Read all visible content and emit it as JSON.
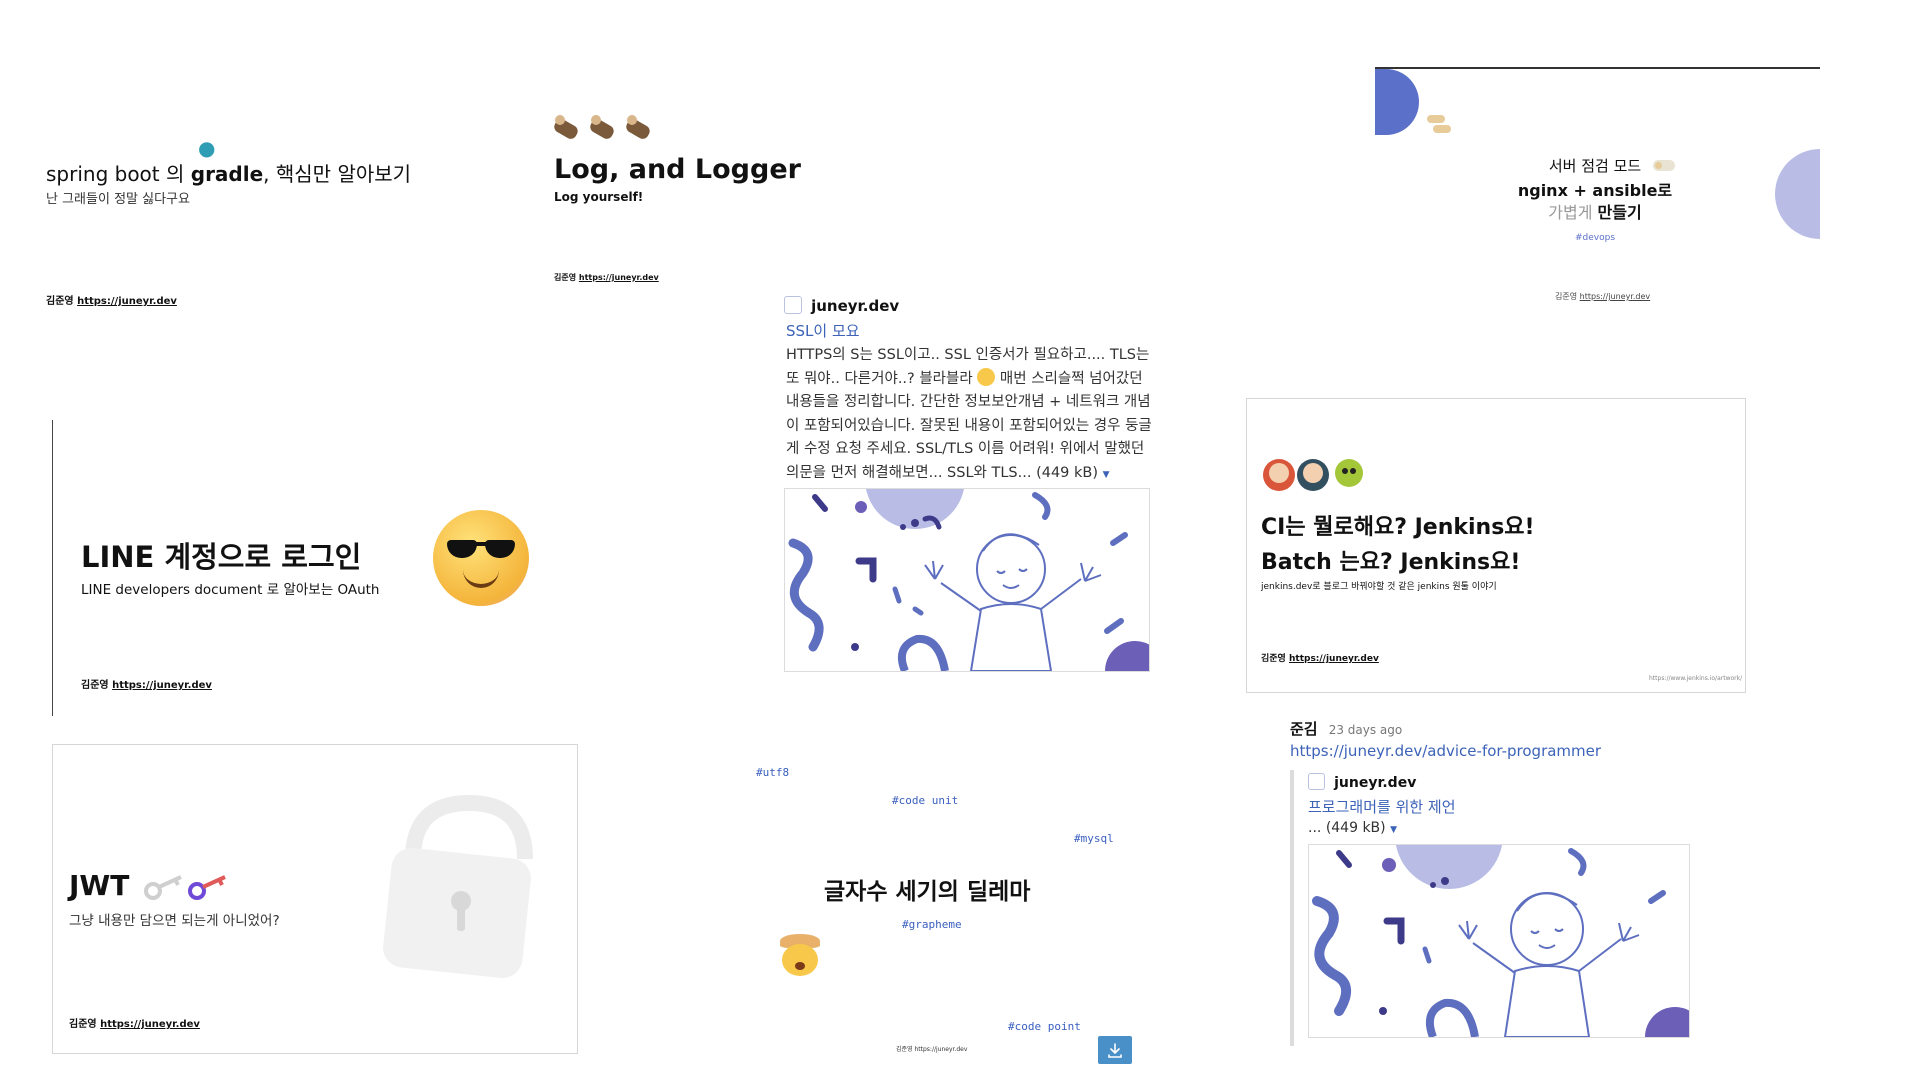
{
  "slides": {
    "gradle": {
      "title_pre": "spring boot 의 ",
      "title_bold": "gradle",
      "title_post": ", 핵심만 알아보기",
      "subtitle": "난 그래들이 정말 싫다구요",
      "author": "김준영",
      "url": "https://juneyr.dev"
    },
    "logger": {
      "title": "Log, and Logger",
      "subtitle": "Log yourself!",
      "author": "김준영",
      "url": "https://juneyr.dev"
    },
    "server": {
      "line1": "서버 점검 모드",
      "line2": "nginx + ansible로",
      "line3_light": "가볍게 ",
      "line3_bold": "만들기",
      "tag": "#devops",
      "author": "김준영",
      "url": "https://juneyr.dev"
    },
    "line": {
      "title": "LINE 계정으로 로그인",
      "subtitle": "LINE developers document 로 알아보는 OAuth",
      "author": "김준영",
      "url": "https://juneyr.dev"
    },
    "jenkins": {
      "line1": "CI는 뭘로해요? Jenkins요!",
      "line2": "Batch 는요? Jenkins요!",
      "subtitle": "jenkins.dev로 블로그 바꿔야할 것 같은 jenkins 원툴 이야기",
      "author": "김준영",
      "url": "https://juneyr.dev",
      "credit": "https://www.jenkins.io/artwork/"
    },
    "jwt": {
      "title": "JWT",
      "subtitle": "그냥 내용만 담으면 되는게 아니었어?",
      "author": "김준영",
      "url": "https://juneyr.dev"
    },
    "unicode": {
      "title": "글자수 세기의 딜레마",
      "tags": [
        "#utf8",
        "#code unit",
        "#mysql",
        "#grapheme",
        "#code point"
      ],
      "author": "김준영",
      "url": "https://juneyr.dev"
    }
  },
  "ssl_preview": {
    "site": "juneyr.dev",
    "title": "SSL이 모요",
    "body_pre": "HTTPS의 S는 SSL이고.. SSL 인증서가 필요하고.... TLS는 또 뭐야.. 다른거야..? 블라블라",
    "body_post": "매번 스리슬쩍 넘어갔던 내용들을 정리합니다. 간단한 정보보안개념 + 네트워크 개념이 포함되어있습니다. 잘못된 내용이 포함되어있는 경우 둥글게 수정 요청 주세요. SSL/TLS 이름 어려워! 위에서 말했던 의문을 먼저 해결해보면... SSL와 TLS...",
    "size": "(449 kB)"
  },
  "message": {
    "user": "준김",
    "time": "23 days ago",
    "link": "https://juneyr.dev/advice-for-programmer",
    "site": "juneyr.dev",
    "title": "프로그래머를 위한 제언",
    "body": "...",
    "size": "(449 kB)"
  },
  "icons": {
    "download": "download-icon",
    "expand": "caret-down-icon"
  },
  "colors": {
    "link": "#3c63b8",
    "accent_purple": "#6b5fb8",
    "periwinkle": "#b9bde6",
    "doodle_blue": "#5e6fc0",
    "download_bg": "#4a90c8"
  }
}
